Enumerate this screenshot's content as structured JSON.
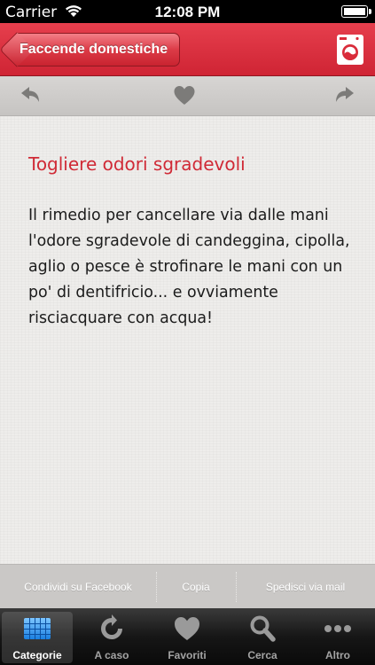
{
  "status_bar": {
    "carrier": "Carrier",
    "time": "12:08 PM"
  },
  "navbar": {
    "back_label": "Faccende domestiche",
    "category_icon": "washing-machine-icon",
    "accent_color": "#d92c3a"
  },
  "toolbar": {
    "icons": [
      "undo-arrow-icon",
      "heart-icon",
      "redo-arrow-icon"
    ]
  },
  "tip": {
    "title": "Togliere odori sgradevoli",
    "body": "Il rimedio per cancellare via dalle mani l'odore sgradevole di candeggina, cipolla, aglio o pesce è strofinare le mani con un po' di dentifricio... e ovviamente risciacquare con acqua!",
    "title_color": "#d02a36"
  },
  "share": {
    "facebook": "Condividi su Facebook",
    "copy": "Copia",
    "mail": "Spedisci via mail"
  },
  "tabs": [
    {
      "label": "Categorie",
      "icon": "grid-icon",
      "selected": true
    },
    {
      "label": "A caso",
      "icon": "refresh-icon",
      "selected": false
    },
    {
      "label": "Favoriti",
      "icon": "heart-icon",
      "selected": false
    },
    {
      "label": "Cerca",
      "icon": "search-icon",
      "selected": false
    },
    {
      "label": "Altro",
      "icon": "more-icon",
      "selected": false
    }
  ]
}
